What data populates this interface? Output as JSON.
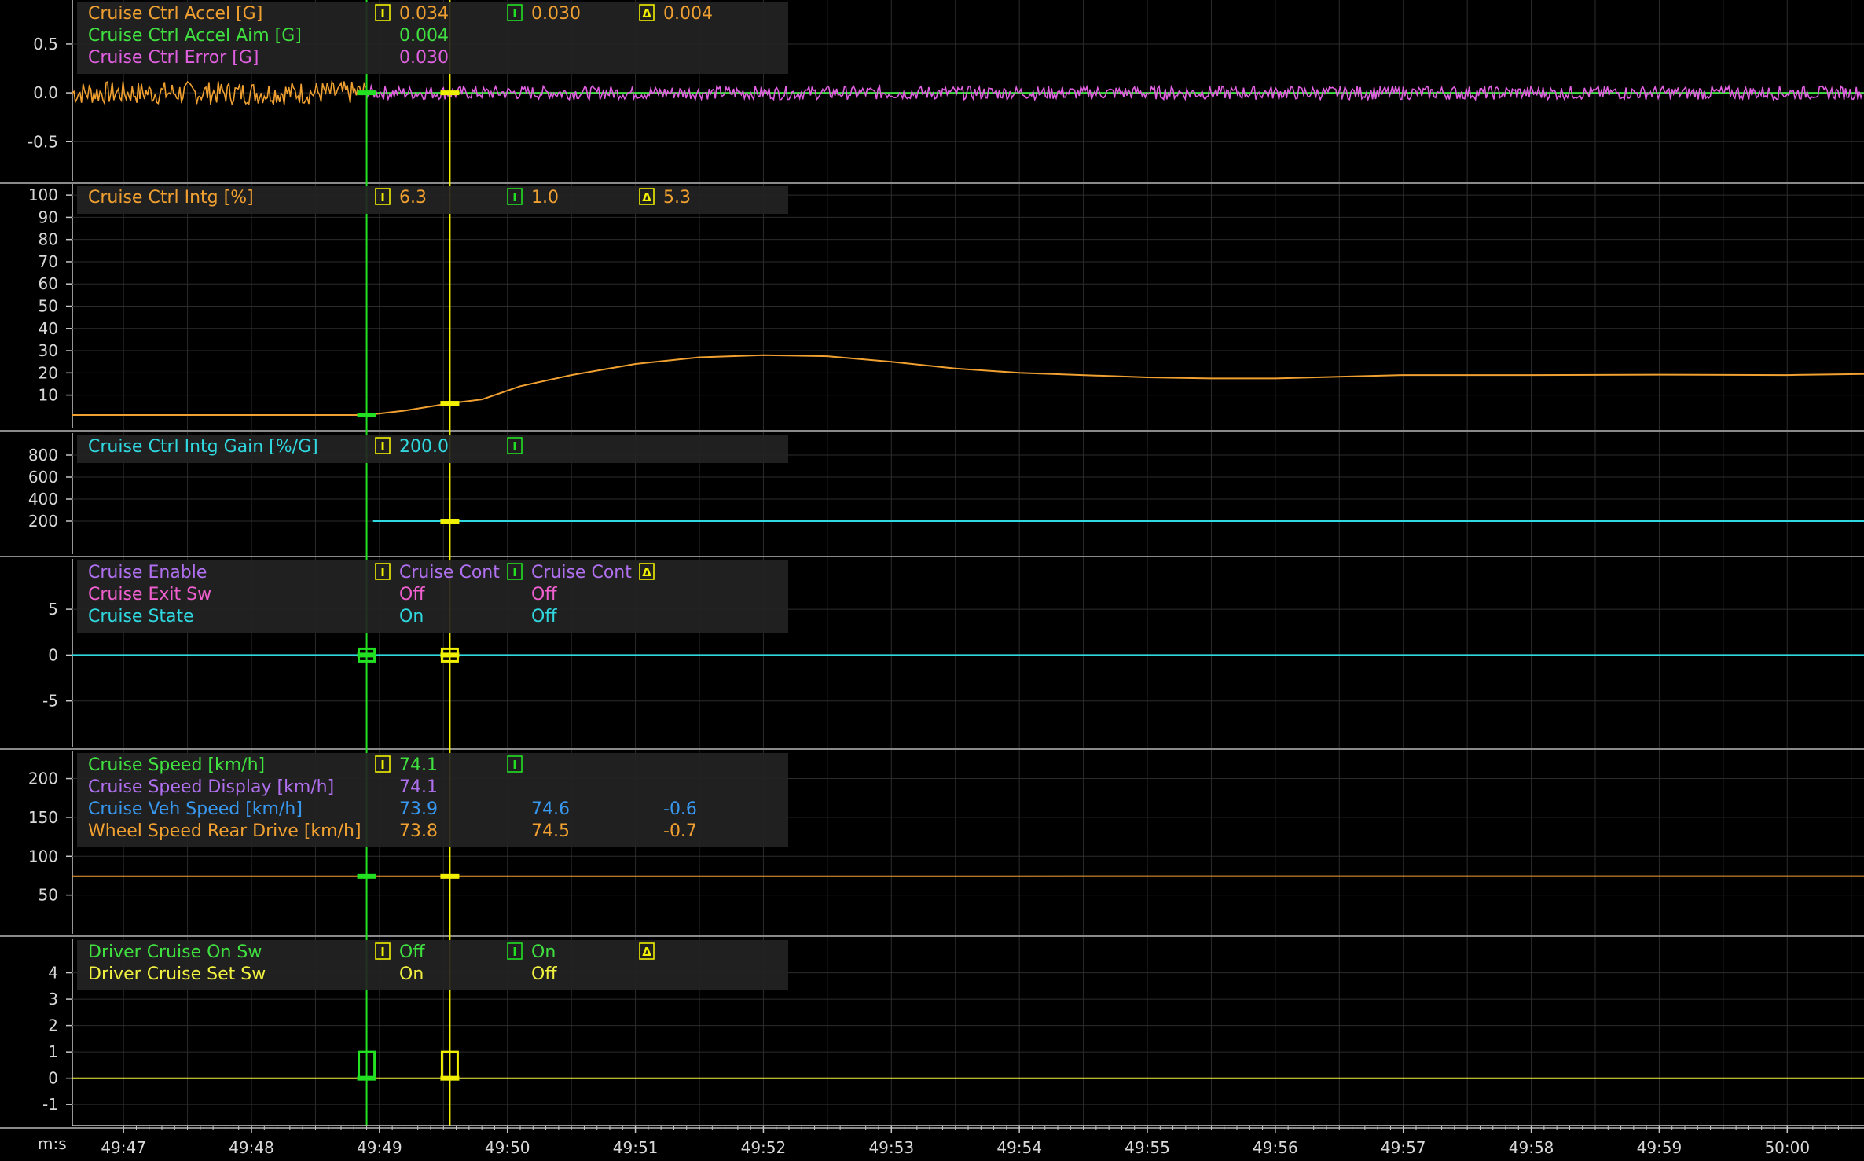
{
  "colors": {
    "background": "#000000",
    "grid": "#2c2c2c",
    "separator": "#8a8a8a",
    "axis": "#c8c8c8",
    "legend_bg": "#232323",
    "cursor_green": "#22e022",
    "cursor_yellow": "#f0f000",
    "orange": "#f0a030",
    "green": "#40e040",
    "magenta": "#e060e0",
    "cyan": "#30d8e0",
    "violet": "#b070f0",
    "pink": "#f060d0",
    "blue": "#3898f0",
    "yellow": "#f0f040"
  },
  "time_axis": {
    "unit_label": "m:s",
    "ticks": [
      "49:47",
      "49:48",
      "49:49",
      "49:50",
      "49:51",
      "49:52",
      "49:53",
      "49:54",
      "49:55",
      "49:56",
      "49:57",
      "49:58",
      "49:59",
      "50:00"
    ],
    "start_s": 46.6,
    "end_s": 60.6
  },
  "cursors": {
    "green_time_s": 48.9,
    "yellow_time_s": 49.55,
    "icon_i": "I",
    "icon_delta": "Δ"
  },
  "chart_data": [
    {
      "type": "line",
      "panel": "accel",
      "ylim": [
        -0.9,
        0.95
      ],
      "yticks": [
        "0.5",
        "0.0",
        "-0.5"
      ],
      "ytick_values": [
        0.5,
        0.0,
        -0.5
      ],
      "series": [
        {
          "name": "Cruise Ctrl Accel [G]",
          "color": "#f0a030",
          "c1": "0.034",
          "c2": "0.030",
          "c3": "0.004",
          "c3icon": "Δ"
        },
        {
          "name": "Cruise Ctrl Accel Aim [G]",
          "color": "#40e040",
          "c1": "0.004",
          "c2": "",
          "c3": "",
          "c3icon": ""
        },
        {
          "name": "Cruise Ctrl Error [G]",
          "color": "#e060e0",
          "c1": "0.030",
          "c2": "",
          "c3": "",
          "c3icon": ""
        }
      ],
      "cursor_icons": {
        "c1": "I",
        "c2": "I"
      },
      "noise": {
        "orange_until_s": 48.9,
        "orange_amplitude": 0.12,
        "magenta_from_s": 48.9,
        "magenta_amplitude": 0.07,
        "aim_value": 0.0
      }
    },
    {
      "type": "line",
      "panel": "intg",
      "ylim": [
        -5,
        105
      ],
      "yticks": [
        "100",
        "90",
        "80",
        "70",
        "60",
        "50",
        "40",
        "30",
        "20",
        "10"
      ],
      "ytick_values": [
        100,
        90,
        80,
        70,
        60,
        50,
        40,
        30,
        20,
        10
      ],
      "series": [
        {
          "name": "Cruise Ctrl Intg [%]",
          "color": "#f0a030",
          "c1": "6.3",
          "c2": "1.0",
          "c3": "5.3",
          "c3icon": "Δ",
          "x": [
            46.6,
            48.9,
            49.2,
            49.55,
            49.8,
            50.1,
            50.5,
            51.0,
            51.5,
            52.0,
            52.5,
            53.0,
            53.5,
            54.0,
            55.0,
            55.5,
            56.0,
            57.0,
            58.0,
            59.0,
            60.0,
            60.6
          ],
          "y": [
            1.0,
            1.0,
            3.0,
            6.3,
            8.0,
            14.0,
            19.0,
            24.0,
            27.0,
            28.0,
            27.5,
            25.0,
            22.0,
            20.0,
            18.0,
            17.5,
            17.5,
            19.0,
            19.0,
            19.2,
            19.0,
            19.5
          ]
        }
      ],
      "cursor_icons": {
        "c1": "I",
        "c2": "I"
      }
    },
    {
      "type": "line",
      "panel": "gain",
      "ylim": [
        -100,
        1000
      ],
      "yticks": [
        "800",
        "600",
        "400",
        "200"
      ],
      "ytick_values": [
        800,
        600,
        400,
        200
      ],
      "series": [
        {
          "name": "Cruise Ctrl Intg Gain [%/G]",
          "color": "#30d8e0",
          "c1": "200.0",
          "c2": "",
          "c3": "",
          "c3icon": "",
          "x": [
            48.95,
            60.6
          ],
          "y": [
            200,
            200
          ]
        }
      ],
      "cursor_icons": {
        "c1": "I",
        "c2": "I"
      }
    },
    {
      "type": "line",
      "panel": "state",
      "ylim": [
        -10,
        10.5
      ],
      "yticks": [
        "5",
        "0",
        "-5"
      ],
      "ytick_values": [
        5,
        0,
        -5
      ],
      "series": [
        {
          "name": "Cruise Enable",
          "color": "#b070f0",
          "c1": "Cruise Cont",
          "c2": "Cruise Cont",
          "c3": "",
          "c3icon": "Δ"
        },
        {
          "name": "Cruise Exit Sw",
          "color": "#f060d0",
          "c1": "Off",
          "c2": "Off",
          "c3": "",
          "c3icon": ""
        },
        {
          "name": "Cruise State",
          "color": "#30d8e0",
          "c1": "On",
          "c2": "Off",
          "c3": "",
          "c3icon": "",
          "x": [
            46.6,
            60.6
          ],
          "y": [
            0,
            0
          ]
        }
      ],
      "cursor_icons": {
        "c1": "I",
        "c2": "I"
      }
    },
    {
      "type": "line",
      "panel": "speed",
      "ylim": [
        0,
        235
      ],
      "yticks": [
        "200",
        "150",
        "100",
        "50"
      ],
      "ytick_values": [
        200,
        150,
        100,
        50
      ],
      "series": [
        {
          "name": "Cruise Speed [km/h]",
          "color": "#40e040",
          "c1": "74.1",
          "c2": "",
          "c3": "",
          "c3icon": ""
        },
        {
          "name": "Cruise Speed Display [km/h]",
          "color": "#b070f0",
          "c1": "74.1",
          "c2": "",
          "c3": "",
          "c3icon": ""
        },
        {
          "name": "Cruise Veh Speed [km/h]",
          "color": "#3898f0",
          "c1": "73.9",
          "c2": "74.6",
          "c3": "-0.6",
          "c3icon": ""
        },
        {
          "name": "Wheel Speed Rear Drive [km/h]",
          "color": "#f0a030",
          "c1": "73.8",
          "c2": "74.5",
          "c3": "-0.7",
          "c3icon": "",
          "x": [
            46.6,
            60.6
          ],
          "y": [
            74.1,
            74.3
          ]
        }
      ],
      "cursor_icons": {
        "c1": "I",
        "c2": "I"
      }
    },
    {
      "type": "line",
      "panel": "driver",
      "ylim": [
        -1.8,
        5.3
      ],
      "yticks": [
        "4",
        "3",
        "2",
        "1",
        "0",
        "-1"
      ],
      "ytick_values": [
        4,
        3,
        2,
        1,
        0,
        -1
      ],
      "series": [
        {
          "name": "Driver Cruise On Sw",
          "color": "#40e040",
          "c1": "Off",
          "c2": "On",
          "c3": "",
          "c3icon": "Δ"
        },
        {
          "name": "Driver Cruise Set Sw",
          "color": "#f0f040",
          "c1": "On",
          "c2": "Off",
          "c3": "",
          "c3icon": "",
          "x": [
            46.6,
            60.6
          ],
          "y": [
            0,
            0
          ]
        }
      ],
      "cursor_icons": {
        "c1": "I",
        "c2": "I"
      }
    }
  ]
}
